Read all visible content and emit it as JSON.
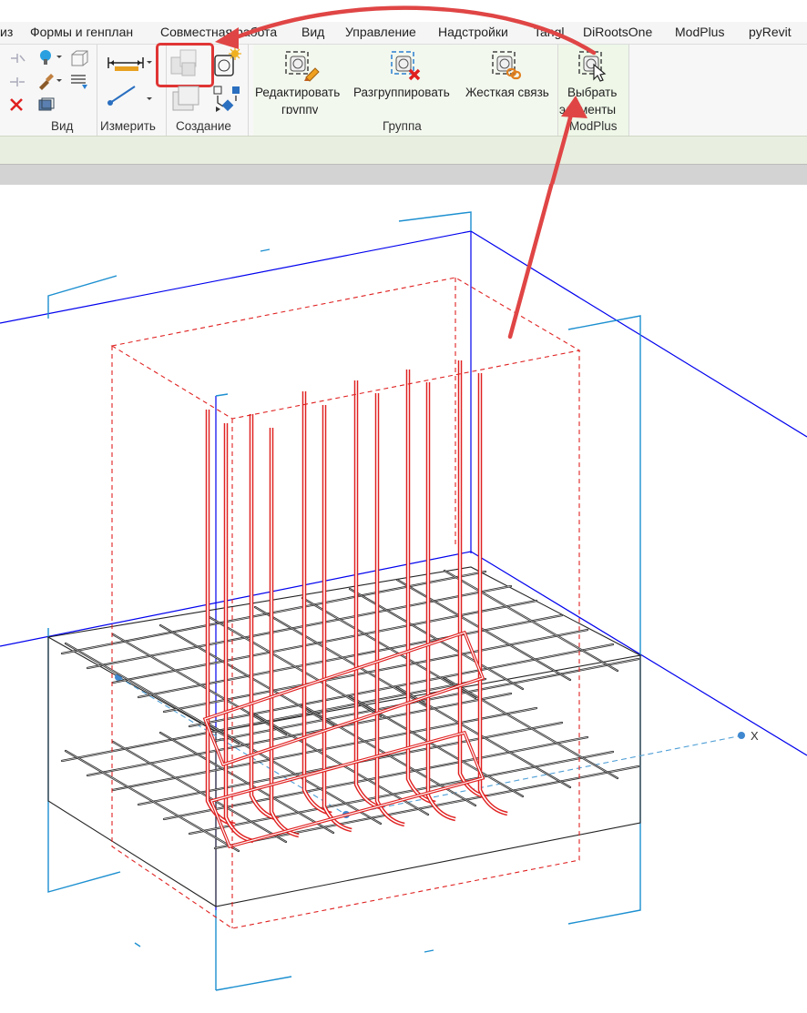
{
  "tabs": [
    {
      "label": "из"
    },
    {
      "label": "Формы и генплан"
    },
    {
      "label": "Совместная работа"
    },
    {
      "label": "Вид"
    },
    {
      "label": "Управление"
    },
    {
      "label": "Надстройки"
    },
    {
      "label": "Tangl"
    },
    {
      "label": "DiRootsOne"
    },
    {
      "label": "ModPlus"
    },
    {
      "label": "pyRevit"
    }
  ],
  "panels": {
    "view": {
      "label": "Вид"
    },
    "measure": {
      "label": "Измерить"
    },
    "create": {
      "label": "Создание"
    },
    "group": {
      "label": "Группа",
      "buttons": [
        {
          "label": "Редактировать",
          "label2": "группу",
          "icon": "edit-group-icon"
        },
        {
          "label": "Разгруппировать",
          "icon": "ungroup-icon"
        },
        {
          "label": "Жесткая связь",
          "icon": "rigid-link-icon"
        }
      ]
    },
    "modplus": {
      "label": "ModPlus",
      "button": {
        "label": "Выбрать",
        "label2": "элементы",
        "icon": "select-elements-icon"
      }
    }
  },
  "viewport": {
    "axis_label": "X",
    "colors": {
      "rebar": "#e02020",
      "section_box": "#0000ee",
      "crop": "#1c8fd0",
      "annotation": "#e04545",
      "highlight": "#e03030"
    }
  }
}
